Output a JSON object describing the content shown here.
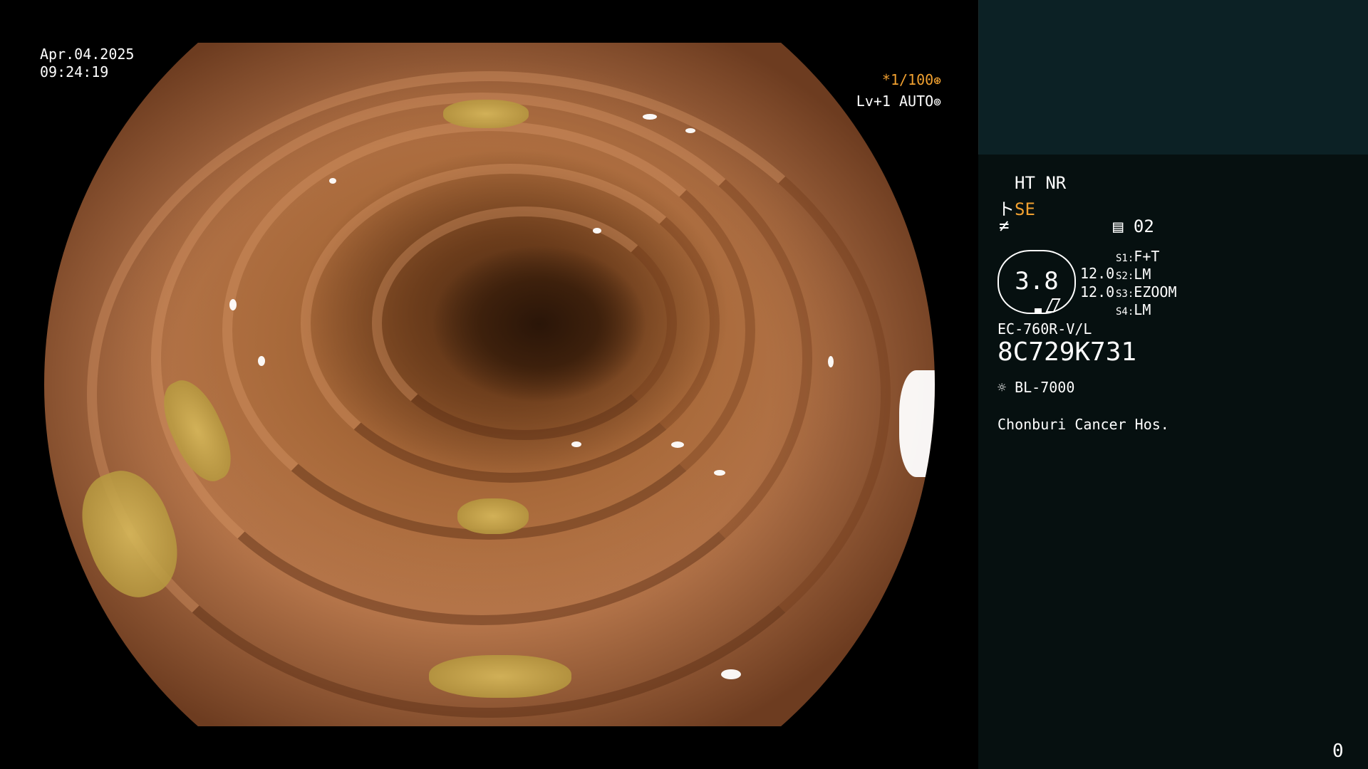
{
  "overlay": {
    "date": "Apr.04.2025",
    "time": "09:24:19",
    "shutter": "*1/100",
    "shutter_icon": "aperture-icon",
    "level_label": "Lv+1 AUTO",
    "auto_icon": "iris-icon"
  },
  "info": {
    "ht_nr": "HT NR",
    "se_prefix": "ト",
    "se_label": "SE",
    "enhance_symbol": "≠",
    "mode_icon": "memory-icon",
    "mode_number": "02",
    "zoom_value": "3.8",
    "mag_1": "12.0",
    "mag_2": "12.0",
    "settings": [
      {
        "key": "S1:",
        "value": "F+T"
      },
      {
        "key": "S2:",
        "value": "LM"
      },
      {
        "key": "S3:",
        "value": "EZOOM"
      },
      {
        "key": "S4:",
        "value": "LM"
      }
    ],
    "scope_model": "EC-760R-V/L",
    "scope_serial": "8C729K731",
    "light_icon": "sun-icon",
    "light_source": "BL-7000",
    "hospital": "Chonburi Cancer Hos.",
    "counter": "0"
  },
  "colors": {
    "accent": "#f0a030",
    "panel_top": "#0c2125",
    "panel": "#061010"
  }
}
